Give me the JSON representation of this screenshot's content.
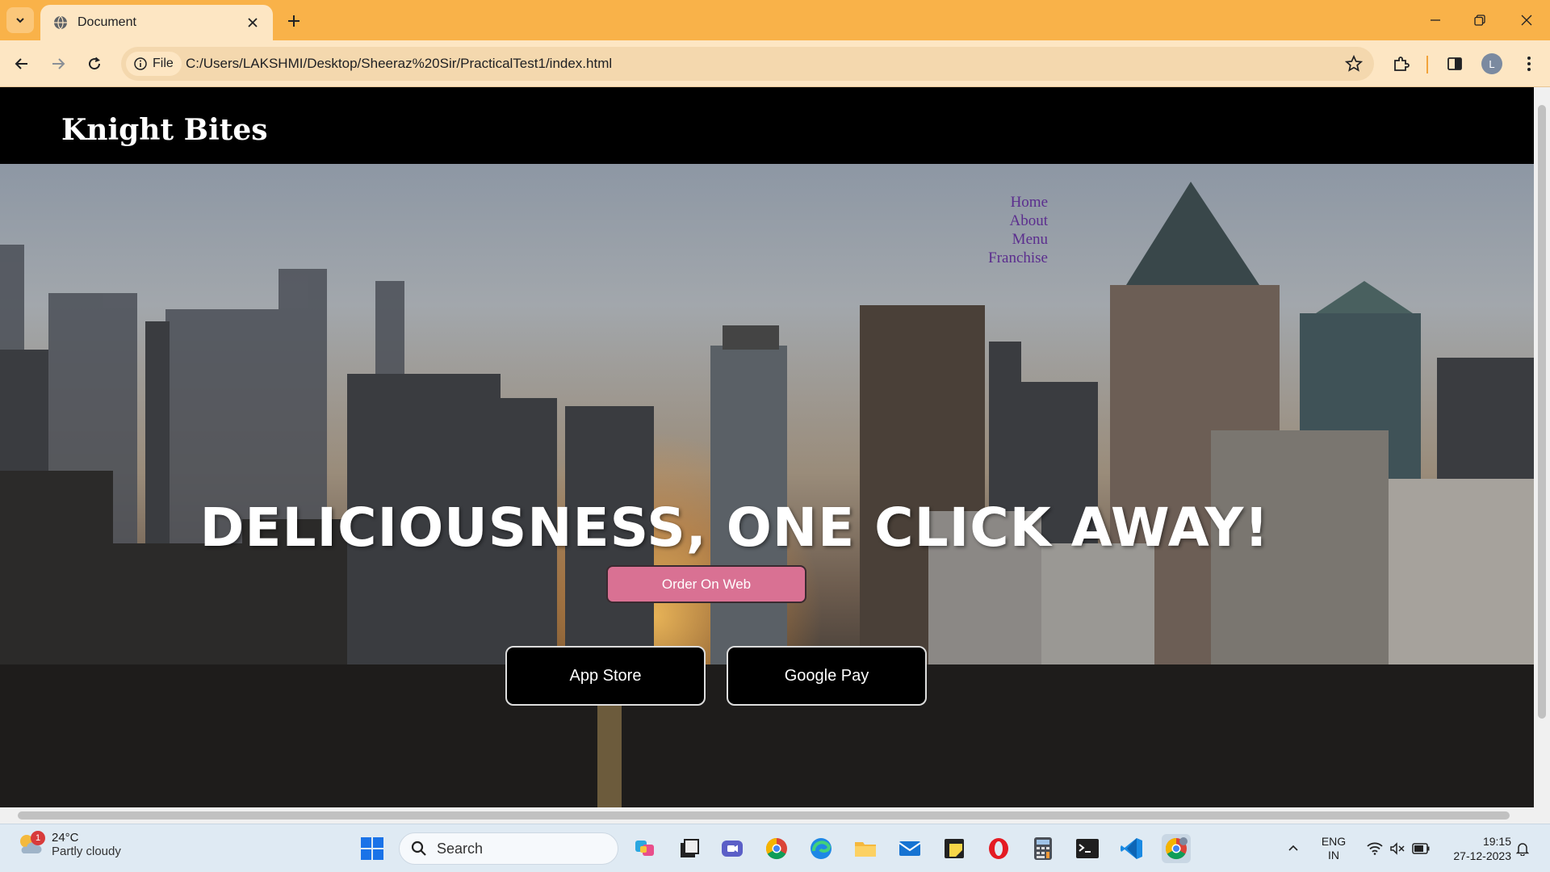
{
  "browser": {
    "tab_title": "Document",
    "chip_label": "File",
    "url": "C:/Users/LAKSHMI/Desktop/Sheeraz%20Sir/PracticalTest1/index.html",
    "profile_initial": "L",
    "accent_color": "#f9b249"
  },
  "site": {
    "brand": "Knight Bites",
    "nav": [
      "Home",
      "About",
      "Menu",
      "Franchise"
    ],
    "headline": "DELICIOUSNESS, ONE CLICK AWAY!",
    "order_button": "Order On Web",
    "store_buttons": [
      "App Store",
      "Google Pay"
    ],
    "order_button_color": "#d97193"
  },
  "taskbar": {
    "weather_badge": "1",
    "temperature": "24°C",
    "condition": "Partly cloudy",
    "search_label": "Search",
    "language": "ENG",
    "region": "IN",
    "time": "19:15",
    "date": "27-12-2023"
  }
}
